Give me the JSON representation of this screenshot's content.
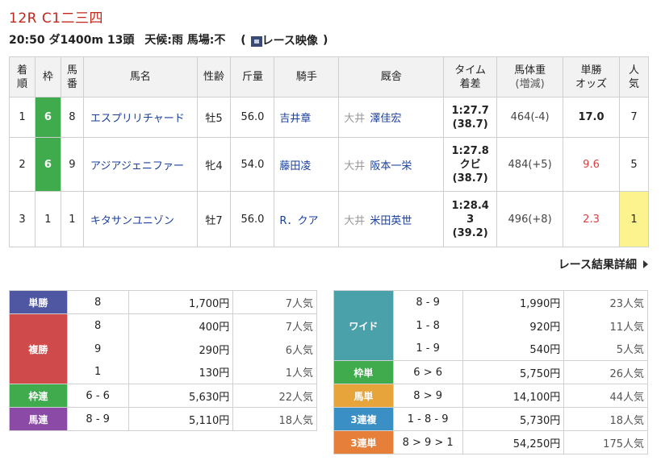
{
  "race": {
    "title": "12R C1二三四",
    "time": "20:50",
    "course": "ダ1400m",
    "runners": "13頭",
    "weather": "天候:雨",
    "track": "馬場:不",
    "video_label": "レース映像",
    "paren_open": "(",
    "paren_close": ")"
  },
  "results": {
    "headers": {
      "rank": [
        "着",
        "順"
      ],
      "waku": "枠",
      "num": [
        "馬",
        "番"
      ],
      "name": "馬名",
      "sex_age": "性齢",
      "kinryo": "斤量",
      "jockey": "騎手",
      "stable": "厩舎",
      "time": [
        "タイム",
        "着差"
      ],
      "weight": [
        "馬体重",
        "(増減)"
      ],
      "odds": [
        "単勝",
        "オッズ"
      ],
      "pop": [
        "人",
        "気"
      ]
    },
    "rows": [
      {
        "rank": "1",
        "waku": "6",
        "num": "8",
        "name": "エスプリリチャード",
        "sex_age": "牡5",
        "kinryo": "56.0",
        "jockey": "吉井章",
        "area": "大井",
        "trainer": "澤佳宏",
        "time": "1:27.7",
        "margin": "",
        "last3f": "(38.7)",
        "weight": "464(-4)",
        "odds": "17.0",
        "pop": "7"
      },
      {
        "rank": "2",
        "waku": "6",
        "num": "9",
        "name": "アジアジェニファー",
        "sex_age": "牝4",
        "kinryo": "54.0",
        "jockey": "藤田凌",
        "area": "大井",
        "trainer": "阪本一栄",
        "time": "1:27.8",
        "margin": "クビ",
        "last3f": "(38.7)",
        "weight": "484(+5)",
        "odds": "9.6",
        "pop": "5"
      },
      {
        "rank": "3",
        "waku": "1",
        "num": "1",
        "name": "キタサンユニゾン",
        "sex_age": "牡7",
        "kinryo": "56.0",
        "jockey": "R．クア",
        "area": "大井",
        "trainer": "米田英世",
        "time": "1:28.4",
        "margin": "3",
        "last3f": "(39.2)",
        "weight": "496(+8)",
        "odds": "2.3",
        "pop": "1"
      }
    ]
  },
  "detail_link": "レース結果詳細",
  "payouts_left": {
    "tansho": {
      "label": "単勝",
      "rows": [
        {
          "combo": "8",
          "amount": "1,700円",
          "pop": "7人気"
        }
      ]
    },
    "fukusho": {
      "label": "複勝",
      "rows": [
        {
          "combo": "8",
          "amount": "400円",
          "pop": "7人気"
        },
        {
          "combo": "9",
          "amount": "290円",
          "pop": "6人気"
        },
        {
          "combo": "1",
          "amount": "130円",
          "pop": "1人気"
        }
      ]
    },
    "wakuren": {
      "label": "枠連",
      "rows": [
        {
          "combo": "6 - 6",
          "amount": "5,630円",
          "pop": "22人気"
        }
      ]
    },
    "umaren": {
      "label": "馬連",
      "rows": [
        {
          "combo": "8 - 9",
          "amount": "5,110円",
          "pop": "18人気"
        }
      ]
    }
  },
  "payouts_right": {
    "wide": {
      "label": "ワイド",
      "rows": [
        {
          "combo": "8 - 9",
          "amount": "1,990円",
          "pop": "23人気"
        },
        {
          "combo": "1 - 8",
          "amount": "920円",
          "pop": "11人気"
        },
        {
          "combo": "1 - 9",
          "amount": "540円",
          "pop": "5人気"
        }
      ]
    },
    "wakutan": {
      "label": "枠単",
      "rows": [
        {
          "combo": "6 > 6",
          "amount": "5,750円",
          "pop": "26人気"
        }
      ]
    },
    "umatan": {
      "label": "馬単",
      "rows": [
        {
          "combo": "8 > 9",
          "amount": "14,100円",
          "pop": "44人気"
        }
      ]
    },
    "sanrenpuku": {
      "label": "3連複",
      "rows": [
        {
          "combo": "1 - 8 - 9",
          "amount": "5,730円",
          "pop": "18人気"
        }
      ]
    },
    "sanrentan": {
      "label": "3連単",
      "rows": [
        {
          "combo": "8 > 9 > 1",
          "amount": "54,250円",
          "pop": "175人気"
        }
      ]
    }
  },
  "colors": {
    "title_red": "#c0281e",
    "waku6_green": "#3fab4c",
    "link_blue": "#1a3f9a",
    "odds_red": "#d94040",
    "pop_highlight": "#fdf38e",
    "tansho": "#4f57a3",
    "fukusho": "#cf4a4a",
    "wakuren": "#3fab4c",
    "umaren": "#8a4aa6",
    "wide": "#4aa1aa",
    "wakutan": "#3fab4c",
    "umatan": "#e6a43a",
    "sanrenpuku": "#3a8fc4",
    "sanrentan": "#e67f3a"
  },
  "icons": {
    "video": "video-icon",
    "detail_arrow": "chevron-right-icon"
  }
}
